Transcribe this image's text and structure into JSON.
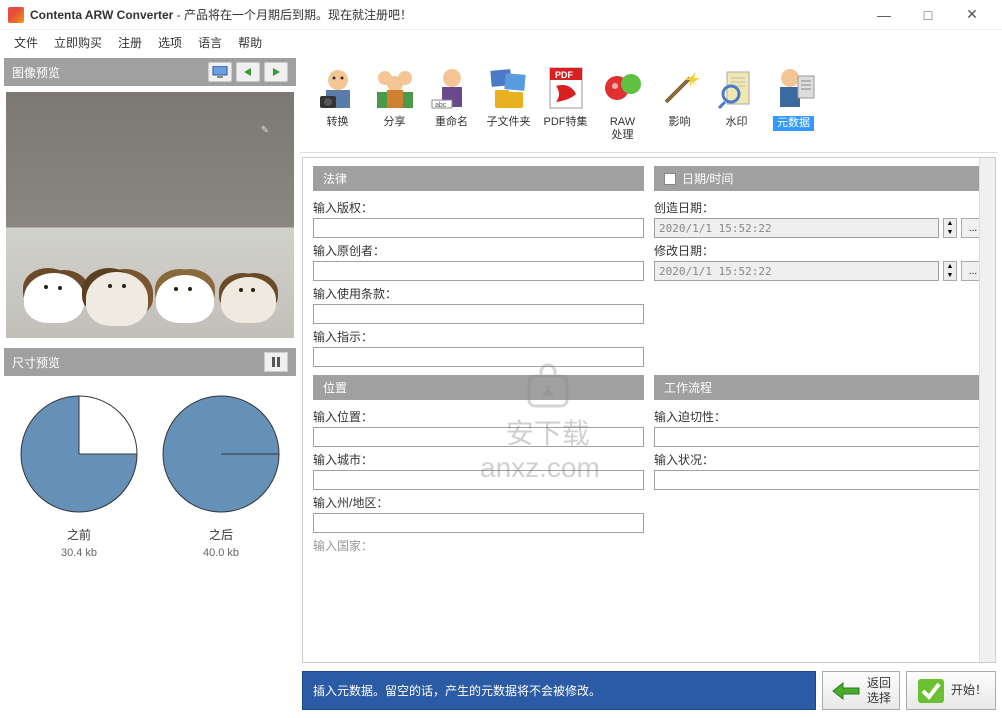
{
  "titlebar": {
    "app": "Contenta ARW Converter",
    "notice": "  - 产品将在一个月期后到期。现在就注册吧！"
  },
  "menu": [
    "文件",
    "立即购买",
    "注册",
    "选项",
    "语言",
    "帮助"
  ],
  "leftPanel": {
    "previewTitle": "图像预览",
    "sizeTitle": "尺寸预览",
    "beforeLabel": "之前",
    "beforeSize": "30.4 kb",
    "afterLabel": "之后",
    "afterSize": "40.0 kb"
  },
  "toolbar": [
    {
      "id": "convert",
      "label": "转换"
    },
    {
      "id": "share",
      "label": "分享"
    },
    {
      "id": "rename",
      "label": "重命名"
    },
    {
      "id": "subfolder",
      "label": "子文件夹"
    },
    {
      "id": "pdf",
      "label": "PDF特集"
    },
    {
      "id": "raw",
      "label": "RAW\n处理"
    },
    {
      "id": "effects",
      "label": "影响"
    },
    {
      "id": "watermark",
      "label": "水印"
    },
    {
      "id": "metadata",
      "label": "元数据"
    }
  ],
  "form": {
    "legal": {
      "title": "法律",
      "copyright": "输入版权：",
      "creator": "输入原创者：",
      "terms": "输入使用条款：",
      "instructions": "输入指示："
    },
    "datetime": {
      "title": "日期/时间",
      "created": "创造日期：",
      "createdVal": "2020/1/1 15:52:22",
      "modified": "修改日期：",
      "modifiedVal": "2020/1/1 15:52:22"
    },
    "location": {
      "title": "位置",
      "loc": "输入位置：",
      "city": "输入城市：",
      "state": "输入州/地区：",
      "country": "输入国家："
    },
    "workflow": {
      "title": "工作流程",
      "urgency": "输入迫切性：",
      "status": "输入状况："
    }
  },
  "bottomBar": {
    "status": "插入元数据。留空的话，产生的元数据将不会被修改。",
    "back": "返回\n选择",
    "start": "开始！"
  },
  "watermark": "安下载\nanxz.com"
}
